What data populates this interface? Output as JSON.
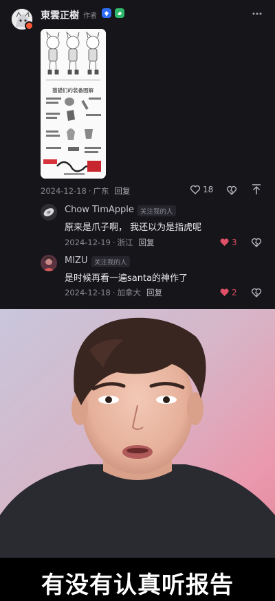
{
  "comment": {
    "author": "東雲正樹",
    "author_tag": "作者",
    "date": "2024-12-18",
    "location": "广东",
    "reply_label": "回复",
    "likes": "18"
  },
  "attachment": {
    "title": "猫猫们的装备图解"
  },
  "replies": [
    {
      "name": "Chow TimApple",
      "follow_tag": "关注我的人",
      "text": "原来是爪子啊，  我还以为是指虎呢",
      "date": "2024-12-19",
      "location": "浙江",
      "reply_label": "回复",
      "likes": "3"
    },
    {
      "name": "MIZU",
      "follow_tag": "关注我的人",
      "text": "是时候再看一遍santa的神作了",
      "date": "2024-12-18",
      "location": "加拿大",
      "reply_label": "回复",
      "likes": "2"
    }
  ],
  "meme": {
    "caption": "有没有认真听报告"
  },
  "colors": {
    "background": "#16161a",
    "heart_red": "#e05067",
    "accent_orange": "#ff5a36"
  },
  "icons": [
    "more-icon",
    "heart-outline-icon",
    "dislike-icon",
    "upload-icon",
    "heart-filled-icon"
  ]
}
